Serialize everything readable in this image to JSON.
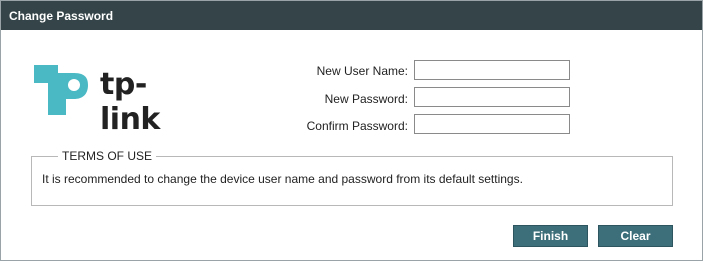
{
  "dialog": {
    "title": "Change Password"
  },
  "logo": {
    "wordmark": "tp-link",
    "brand_color": "#4ab9c4"
  },
  "form": {
    "fields": [
      {
        "label": "New User Name:",
        "value": ""
      },
      {
        "label": "New Password:",
        "value": ""
      },
      {
        "label": "Confirm Password:",
        "value": ""
      }
    ]
  },
  "terms": {
    "heading": "TERMS OF USE",
    "text": "It is recommended to change the device user name and password from its default settings."
  },
  "buttons": {
    "finish_label": "Finish",
    "clear_label": "Clear",
    "color": "#3d6f7a"
  }
}
